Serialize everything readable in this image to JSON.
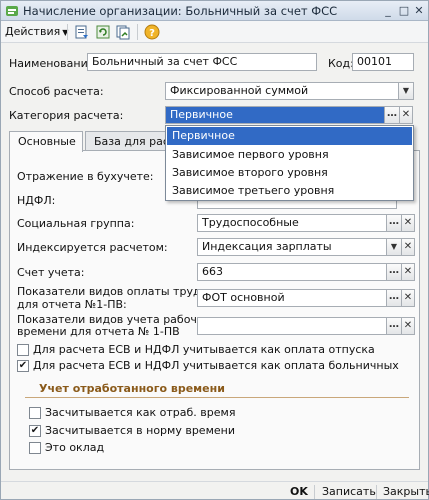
{
  "window": {
    "title": "Начисление организации: Больничный за счет ФСС"
  },
  "toolbar": {
    "actions_label": "Действия"
  },
  "form": {
    "name_label": "Наименование:",
    "name_value": "Больничный за счет ФСС",
    "code_label": "Код:",
    "code_value": "00101",
    "calc_method_label": "Способ расчета:",
    "calc_method_value": "Фиксированной суммой",
    "category_label": "Категория расчета:",
    "category_value": "Первичное"
  },
  "tabs": [
    {
      "label": "Основные"
    },
    {
      "label": "База для расче"
    }
  ],
  "main": {
    "accounting_label": "Отражение в бухучете:",
    "ndfl_label": "НДФЛ:",
    "social_group_label": "Социальная группа:",
    "social_group_value": "Трудоспособные",
    "indexed_label": "Индексируется расчетом:",
    "indexed_value": "Индексация зарплаты",
    "account_label": "Счет учета:",
    "account_value": "663",
    "pay_types_label_1": "Показатели видов оплаты труда",
    "pay_types_label_2": "для отчета №1-ПВ:",
    "pay_types_value": "ФОТ основной",
    "work_time_label_1": "Показатели видов учета рабочего",
    "work_time_label_2": "времени для отчета № 1-ПВ",
    "work_time_value": "",
    "esv_vacation_label": "Для расчета ЕСВ и НДФЛ учитывается как оплата отпуска",
    "esv_vacation_checked": false,
    "esv_sick_label": "Для расчета ЕСВ и НДФЛ учитывается как оплата больничных",
    "esv_sick_checked": true,
    "group_title": "Учет отработанного времени",
    "worked_time_label": "Засчитывается как отраб. время",
    "worked_time_checked": false,
    "norm_time_label": "Засчитывается в норму времени",
    "norm_time_checked": true,
    "salary_label": "Это оклад",
    "salary_checked": false
  },
  "dropdown": {
    "items": [
      "Первичное",
      "Зависимое первого уровня",
      "Зависимое второго уровня",
      "Зависимое третьего уровня"
    ],
    "selected_index": 0
  },
  "bottom": {
    "ok_label": "OK",
    "save_label": "Записать",
    "close_label": "Закрыть"
  },
  "colors": {
    "accent": "#316ac5",
    "group_title": "#8a5a1a"
  }
}
